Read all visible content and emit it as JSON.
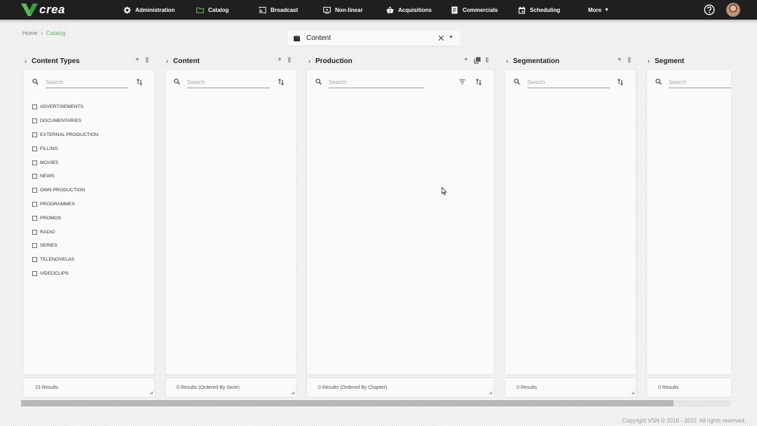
{
  "app": {
    "logo_text": "crea"
  },
  "nav": {
    "items": [
      {
        "label": "Administration",
        "icon": "gear-icon"
      },
      {
        "label": "Catalog",
        "icon": "folder-icon"
      },
      {
        "label": "Broadcast",
        "icon": "cast-icon"
      },
      {
        "label": "Non-linear",
        "icon": "play-screen-icon"
      },
      {
        "label": "Acquisitions",
        "icon": "basket-icon"
      },
      {
        "label": "Commercials",
        "icon": "document-icon"
      },
      {
        "label": "Scheduling",
        "icon": "calendar-icon"
      },
      {
        "label": "More",
        "icon": "caret-down-icon"
      }
    ],
    "active": "Catalog"
  },
  "breadcrumb": {
    "home": "Home",
    "current": "Catalog"
  },
  "selector": {
    "value": "Content",
    "icon": "clapperboard-icon"
  },
  "columns": [
    {
      "title": "Content Types",
      "search_placeholder": "Search",
      "footer": "13 Results",
      "items": [
        "ADVERTISEMENTS",
        "DOCUMENTARIES",
        "EXTERNAL PRODUCTION",
        "FILLING",
        "MOVIES",
        "NEWS",
        "OWN PRODUCTION",
        "PROGRAMMES",
        "PROMOS",
        "RADIO",
        "SERIES",
        "TELENOVELAS",
        "VIDEOCLIPS"
      ]
    },
    {
      "title": "Content",
      "search_placeholder": "Search",
      "footer": "0 Results  (Ordered By Serie)"
    },
    {
      "title": "Production",
      "search_placeholder": "Search",
      "footer": "0 Results  (Ordered By Chapter)"
    },
    {
      "title": "Segmentation",
      "search_placeholder": "Search",
      "footer": "0 Results"
    },
    {
      "title": "Segment",
      "search_placeholder": "Search",
      "footer": "0 Results"
    }
  ],
  "copyright": "Copyright VSN © 2018 - 2022. All rights reserved.",
  "colors": {
    "topbar": "#1f1f1f",
    "accent": "#5cb85c"
  }
}
